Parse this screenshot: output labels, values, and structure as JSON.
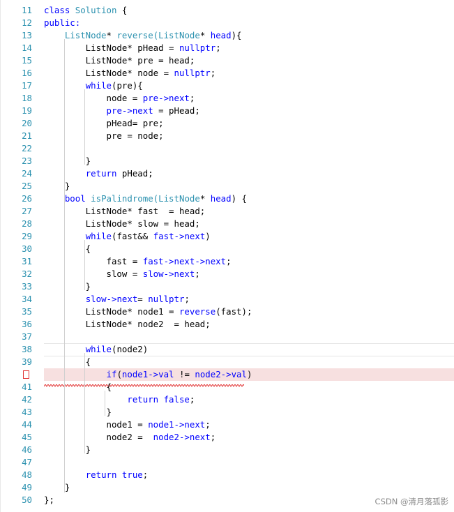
{
  "editor": {
    "lines": [
      {
        "num": "11",
        "tokens": [
          {
            "t": "class ",
            "c": "kw"
          },
          {
            "t": "Solution",
            "c": "ty"
          },
          {
            "t": " {"
          }
        ]
      },
      {
        "num": "12",
        "tokens": [
          {
            "t": "public:",
            "c": "kw"
          }
        ]
      },
      {
        "num": "13",
        "tokens": [
          {
            "t": "    "
          },
          {
            "t": "ListNode",
            "c": "ty"
          },
          {
            "t": "* "
          },
          {
            "t": "reverse(",
            "c": "ty"
          },
          {
            "t": "ListNode",
            "c": "ty"
          },
          {
            "t": "* "
          },
          {
            "t": "head",
            "c": "kw"
          },
          {
            "t": "){"
          }
        ]
      },
      {
        "num": "14",
        "tokens": [
          {
            "t": "        ListNode* pHead = "
          },
          {
            "t": "nullptr",
            "c": "kw"
          },
          {
            "t": ";"
          }
        ]
      },
      {
        "num": "15",
        "tokens": [
          {
            "t": "        ListNode* pre = head;"
          }
        ]
      },
      {
        "num": "16",
        "tokens": [
          {
            "t": "        ListNode* node = "
          },
          {
            "t": "nullptr",
            "c": "kw"
          },
          {
            "t": ";"
          }
        ]
      },
      {
        "num": "17",
        "tokens": [
          {
            "t": "        "
          },
          {
            "t": "while",
            "c": "kw"
          },
          {
            "t": "(pre){"
          }
        ]
      },
      {
        "num": "18",
        "tokens": [
          {
            "t": "            node = "
          },
          {
            "t": "pre->next",
            "c": "kw"
          },
          {
            "t": ";"
          }
        ]
      },
      {
        "num": "19",
        "tokens": [
          {
            "t": "            "
          },
          {
            "t": "pre->next",
            "c": "kw"
          },
          {
            "t": " = pHead;"
          }
        ]
      },
      {
        "num": "20",
        "tokens": [
          {
            "t": "            pHead= pre;"
          }
        ]
      },
      {
        "num": "21",
        "tokens": [
          {
            "t": "            pre = node;"
          }
        ]
      },
      {
        "num": "22",
        "tokens": [
          {
            "t": ""
          }
        ]
      },
      {
        "num": "23",
        "tokens": [
          {
            "t": "        }"
          }
        ]
      },
      {
        "num": "24",
        "tokens": [
          {
            "t": "        "
          },
          {
            "t": "return",
            "c": "kw"
          },
          {
            "t": " pHead;"
          }
        ]
      },
      {
        "num": "25",
        "tokens": [
          {
            "t": "    }"
          }
        ]
      },
      {
        "num": "26",
        "tokens": [
          {
            "t": "    "
          },
          {
            "t": "bool",
            "c": "kw"
          },
          {
            "t": " "
          },
          {
            "t": "isPalindrome(",
            "c": "ty"
          },
          {
            "t": "ListNode",
            "c": "ty"
          },
          {
            "t": "* "
          },
          {
            "t": "head",
            "c": "kw"
          },
          {
            "t": ") {"
          }
        ]
      },
      {
        "num": "27",
        "tokens": [
          {
            "t": "        ListNode* fast  = head;"
          }
        ]
      },
      {
        "num": "28",
        "tokens": [
          {
            "t": "        ListNode* slow = head;"
          }
        ]
      },
      {
        "num": "29",
        "tokens": [
          {
            "t": "        "
          },
          {
            "t": "while",
            "c": "kw"
          },
          {
            "t": "(fast&& "
          },
          {
            "t": "fast->next",
            "c": "kw"
          },
          {
            "t": ")"
          }
        ]
      },
      {
        "num": "30",
        "tokens": [
          {
            "t": "        {"
          }
        ]
      },
      {
        "num": "31",
        "tokens": [
          {
            "t": "            fast = "
          },
          {
            "t": "fast->next->next",
            "c": "kw"
          },
          {
            "t": ";"
          }
        ]
      },
      {
        "num": "32",
        "tokens": [
          {
            "t": "            slow = "
          },
          {
            "t": "slow->next",
            "c": "kw"
          },
          {
            "t": ";"
          }
        ]
      },
      {
        "num": "33",
        "tokens": [
          {
            "t": "        }"
          }
        ]
      },
      {
        "num": "34",
        "tokens": [
          {
            "t": "        "
          },
          {
            "t": "slow->next",
            "c": "kw"
          },
          {
            "t": "= "
          },
          {
            "t": "nullptr",
            "c": "kw"
          },
          {
            "t": ";"
          }
        ]
      },
      {
        "num": "35",
        "tokens": [
          {
            "t": "        ListNode* node1 = "
          },
          {
            "t": "reverse",
            "c": "kw"
          },
          {
            "t": "(fast);"
          }
        ]
      },
      {
        "num": "36",
        "tokens": [
          {
            "t": "        ListNode* node2  = head;"
          }
        ]
      },
      {
        "num": "37",
        "tokens": [
          {
            "t": ""
          }
        ]
      },
      {
        "num": "38",
        "tokens": [
          {
            "t": "        "
          },
          {
            "t": "while",
            "c": "kw"
          },
          {
            "t": "(node2)"
          }
        ]
      },
      {
        "num": "39",
        "tokens": [
          {
            "t": "        {"
          }
        ]
      },
      {
        "num": "40",
        "tokens": [
          {
            "t": "            "
          },
          {
            "t": "if",
            "c": "kw"
          },
          {
            "t": "("
          },
          {
            "t": "node1->val",
            "c": "kw"
          },
          {
            "t": " != "
          },
          {
            "t": "node2->val",
            "c": "kw"
          },
          {
            "t": ")"
          }
        ]
      },
      {
        "num": "41",
        "tokens": [
          {
            "t": "            {"
          }
        ]
      },
      {
        "num": "42",
        "tokens": [
          {
            "t": "                "
          },
          {
            "t": "return",
            "c": "kw"
          },
          {
            "t": " "
          },
          {
            "t": "false",
            "c": "kw"
          },
          {
            "t": ";"
          }
        ]
      },
      {
        "num": "43",
        "tokens": [
          {
            "t": "            }"
          }
        ]
      },
      {
        "num": "44",
        "tokens": [
          {
            "t": "            node1 = "
          },
          {
            "t": "node1->next",
            "c": "kw"
          },
          {
            "t": ";"
          }
        ]
      },
      {
        "num": "45",
        "tokens": [
          {
            "t": "            node2 =  "
          },
          {
            "t": "node2->next",
            "c": "kw"
          },
          {
            "t": ";"
          }
        ]
      },
      {
        "num": "46",
        "tokens": [
          {
            "t": "        }"
          }
        ]
      },
      {
        "num": "47",
        "tokens": [
          {
            "t": ""
          }
        ]
      },
      {
        "num": "48",
        "tokens": [
          {
            "t": "        "
          },
          {
            "t": "return",
            "c": "kw"
          },
          {
            "t": " "
          },
          {
            "t": "true",
            "c": "kw"
          },
          {
            "t": ";"
          }
        ]
      },
      {
        "num": "49",
        "tokens": [
          {
            "t": "    }"
          }
        ]
      },
      {
        "num": "50",
        "tokens": [
          {
            "t": "};"
          }
        ]
      }
    ],
    "error_line": "40",
    "current_line": "38"
  },
  "watermark": "CSDN @清月落孤影",
  "colors": {
    "keyword": "#0000ff",
    "type": "#2b91af",
    "line_number": "#2b91af",
    "error_highlight": "#f7e0e0",
    "breakpoint": "#e03030",
    "squiggle": "#e03030"
  }
}
